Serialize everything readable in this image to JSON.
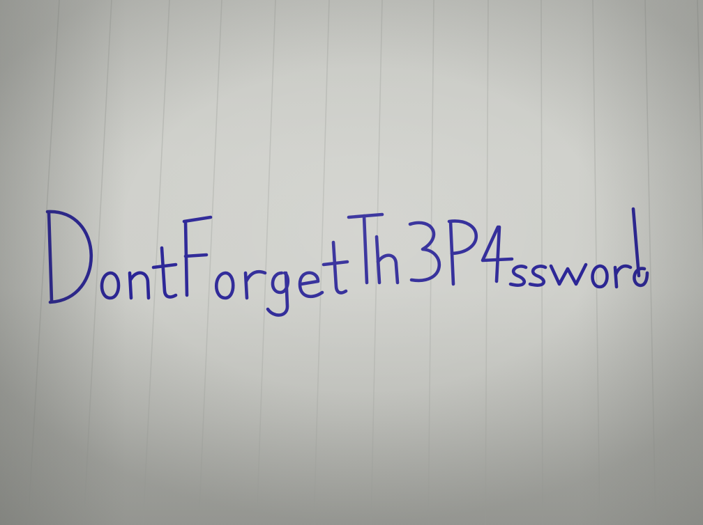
{
  "photo": {
    "subject": "handwritten-note-on-ruled-paper",
    "ink_color": "#2a2496",
    "paper_color": "#cfd0cb",
    "rule_color": "#b2b4af"
  },
  "note": {
    "text": "DontForgetTh3P4ssword"
  }
}
